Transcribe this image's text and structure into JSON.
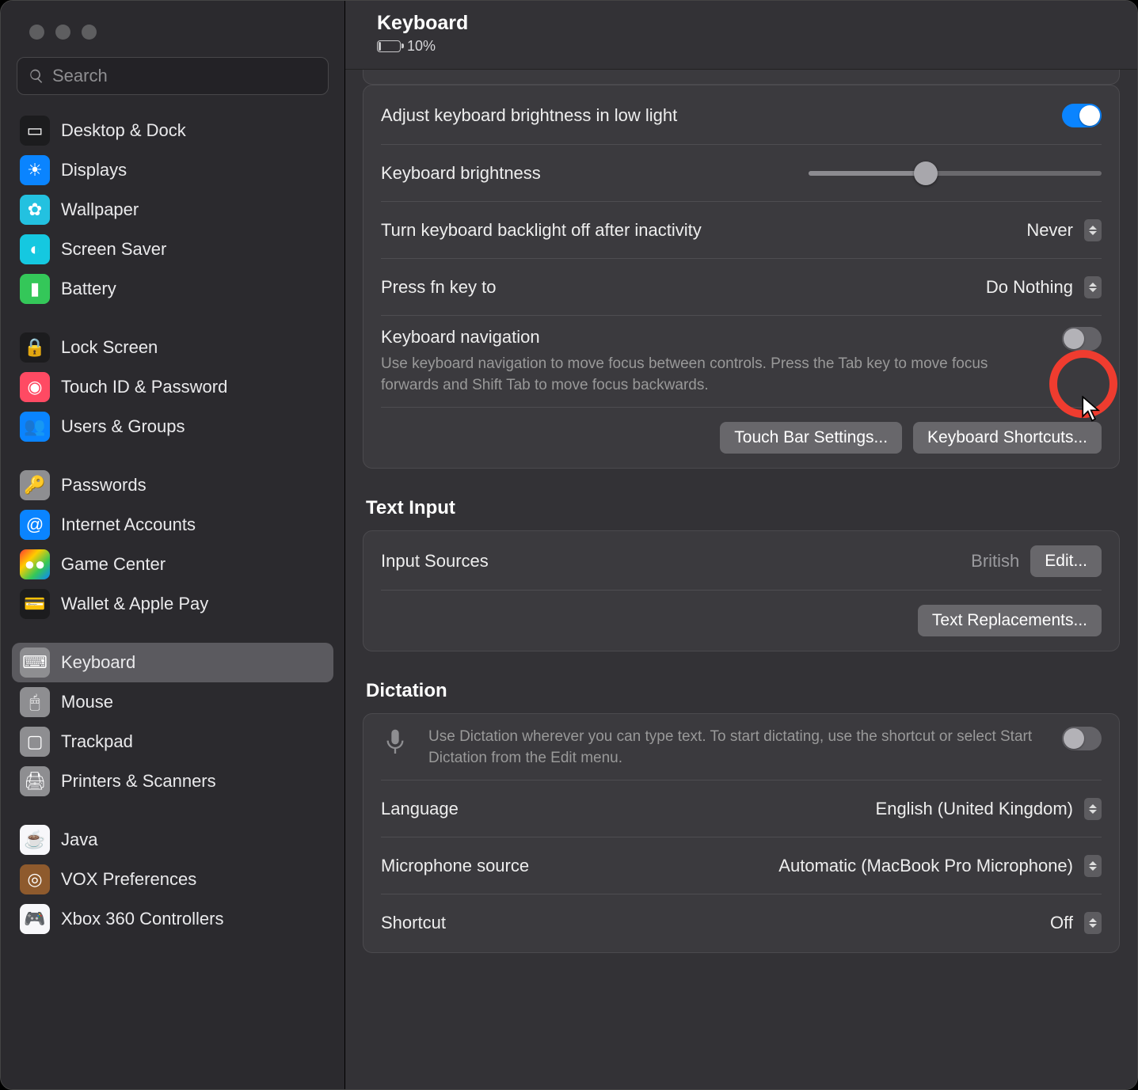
{
  "header": {
    "title": "Keyboard",
    "battery_pct": "10%"
  },
  "search": {
    "placeholder": "Search"
  },
  "sidebar": {
    "groups": [
      [
        {
          "id": "desktop-dock",
          "label": "Desktop & Dock",
          "bg": "#1c1c1e",
          "glyph": "▭"
        },
        {
          "id": "displays",
          "label": "Displays",
          "bg": "#0a84ff",
          "glyph": "☀"
        },
        {
          "id": "wallpaper",
          "label": "Wallpaper",
          "bg": "#23c1e0",
          "glyph": "✿"
        },
        {
          "id": "screen-saver",
          "label": "Screen Saver",
          "bg": "#15c8e0",
          "glyph": "◐"
        },
        {
          "id": "battery",
          "label": "Battery",
          "bg": "#34c759",
          "glyph": "▮"
        }
      ],
      [
        {
          "id": "lock-screen",
          "label": "Lock Screen",
          "bg": "#1c1c1e",
          "glyph": "🔒"
        },
        {
          "id": "touch-id",
          "label": "Touch ID & Password",
          "bg": "#ff4a63",
          "glyph": "◉"
        },
        {
          "id": "users-groups",
          "label": "Users & Groups",
          "bg": "#0a84ff",
          "glyph": "👥"
        }
      ],
      [
        {
          "id": "passwords",
          "label": "Passwords",
          "bg": "#8e8e91",
          "glyph": "🔑"
        },
        {
          "id": "internet-accounts",
          "label": "Internet Accounts",
          "bg": "#0a84ff",
          "glyph": "@"
        },
        {
          "id": "game-center",
          "label": "Game Center",
          "bg": "linear-gradient(135deg,#ff3b30,#ffcc00,#34c759,#0a84ff)",
          "glyph": "●●"
        },
        {
          "id": "wallet",
          "label": "Wallet & Apple Pay",
          "bg": "#1c1c1e",
          "glyph": "💳"
        }
      ],
      [
        {
          "id": "keyboard",
          "label": "Keyboard",
          "bg": "#8e8e91",
          "glyph": "⌨",
          "selected": true
        },
        {
          "id": "mouse",
          "label": "Mouse",
          "bg": "#8e8e91",
          "glyph": "🖱"
        },
        {
          "id": "trackpad",
          "label": "Trackpad",
          "bg": "#8e8e91",
          "glyph": "▢"
        },
        {
          "id": "printers",
          "label": "Printers & Scanners",
          "bg": "#8e8e91",
          "glyph": "🖨"
        }
      ],
      [
        {
          "id": "java",
          "label": "Java",
          "bg": "#f7f7fa",
          "glyph": "☕"
        },
        {
          "id": "vox",
          "label": "VOX Preferences",
          "bg": "#8e5a2d",
          "glyph": "◎"
        },
        {
          "id": "xbox",
          "label": "Xbox 360 Controllers",
          "bg": "#f7f7fa",
          "glyph": "🎮"
        }
      ]
    ]
  },
  "keyboard_panel": {
    "adjust_brightness_label": "Adjust keyboard brightness in low light",
    "adjust_brightness_on": true,
    "brightness_label": "Keyboard brightness",
    "brightness_pct": 40,
    "backlight_off_label": "Turn keyboard backlight off after inactivity",
    "backlight_off_value": "Never",
    "fn_label": "Press fn key to",
    "fn_value": "Do Nothing",
    "nav_label": "Keyboard navigation",
    "nav_desc": "Use keyboard navigation to move focus between controls. Press the Tab key to move focus forwards and Shift Tab to move focus backwards.",
    "nav_on": false,
    "touchbar_btn": "Touch Bar Settings...",
    "shortcuts_btn": "Keyboard Shortcuts..."
  },
  "text_input": {
    "title": "Text Input",
    "input_sources_label": "Input Sources",
    "input_sources_value": "British",
    "edit_btn": "Edit...",
    "replacements_btn": "Text Replacements..."
  },
  "dictation": {
    "title": "Dictation",
    "desc": "Use Dictation wherever you can type text. To start dictating, use the shortcut or select Start Dictation from the Edit menu.",
    "on": false,
    "language_label": "Language",
    "language_value": "English (United Kingdom)",
    "mic_label": "Microphone source",
    "mic_value": "Automatic (MacBook Pro Microphone)",
    "shortcut_label": "Shortcut",
    "shortcut_value": "Off"
  }
}
